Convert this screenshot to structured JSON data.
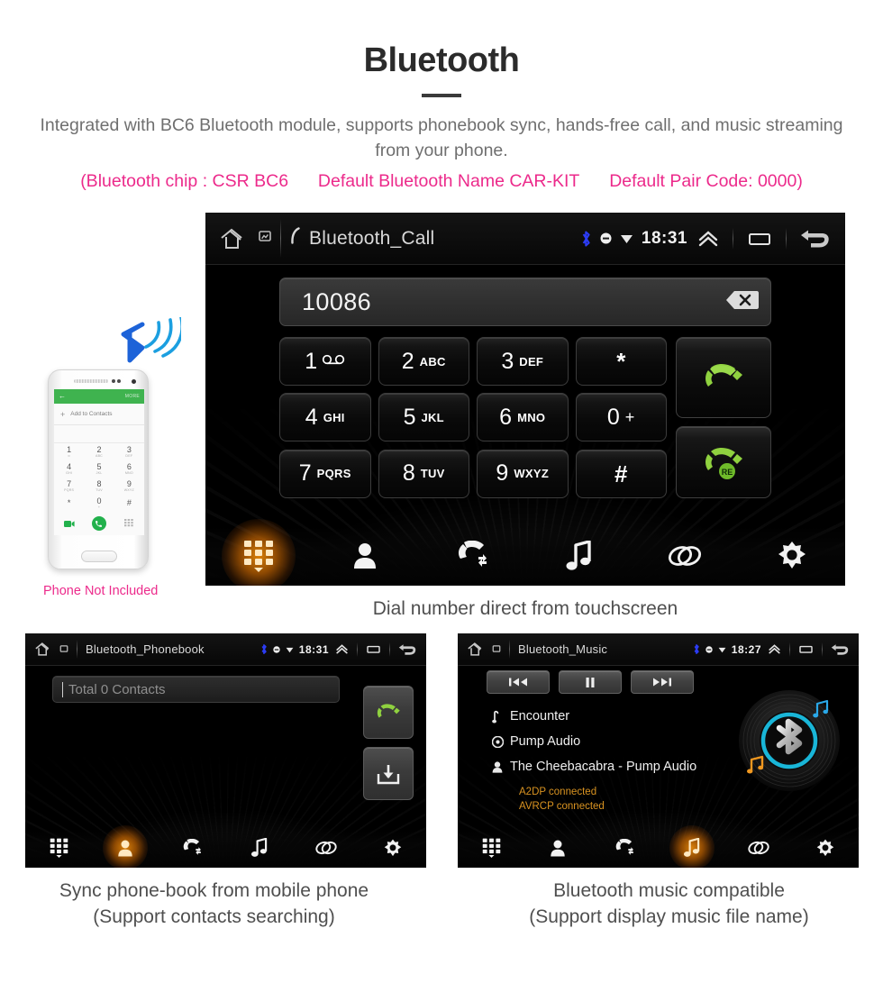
{
  "header": {
    "title": "Bluetooth",
    "description": "Integrated with BC6 Bluetooth module, supports phonebook sync, hands-free call, and music streaming from your phone.",
    "spec_chip": "(Bluetooth chip : CSR BC6",
    "spec_name": "Default Bluetooth Name CAR-KIT",
    "spec_pair": "Default Pair Code: 0000)",
    "accent_pink": "#ec2a8b",
    "text_grey": "#6f6f6f"
  },
  "illustration": {
    "note": "Phone Not Included",
    "phone_screen": {
      "more_label": "MORE",
      "add_contacts": "Add to Contacts",
      "keys": [
        {
          "d": "1",
          "l": "∞"
        },
        {
          "d": "2",
          "l": "ABC"
        },
        {
          "d": "3",
          "l": "DEF"
        },
        {
          "d": "4",
          "l": "GHI"
        },
        {
          "d": "5",
          "l": "JKL"
        },
        {
          "d": "6",
          "l": "MNO"
        },
        {
          "d": "7",
          "l": "PQRS"
        },
        {
          "d": "8",
          "l": "TUV"
        },
        {
          "d": "9",
          "l": "WXYZ"
        },
        {
          "d": "*",
          "l": ""
        },
        {
          "d": "0",
          "l": "+"
        },
        {
          "d": "#",
          "l": ""
        }
      ]
    }
  },
  "call_screen": {
    "status": {
      "title": "Bluetooth_Call",
      "clock": "18:31",
      "bluetooth_color": "#2c3cf5"
    },
    "dial": {
      "value": "10086",
      "backspace_icon": "backspace-icon"
    },
    "keys": [
      {
        "digit": "1",
        "letters": "voicemail",
        "type": "voicemail"
      },
      {
        "digit": "2",
        "letters": "ABC",
        "type": "digit"
      },
      {
        "digit": "3",
        "letters": "DEF",
        "type": "digit"
      },
      {
        "digit": "*",
        "letters": "",
        "type": "symbol"
      },
      {
        "digit": "4",
        "letters": "GHI",
        "type": "digit"
      },
      {
        "digit": "5",
        "letters": "JKL",
        "type": "digit"
      },
      {
        "digit": "6",
        "letters": "MNO",
        "type": "digit"
      },
      {
        "digit": "0",
        "letters": "+",
        "type": "digit"
      },
      {
        "digit": "7",
        "letters": "PQRS",
        "type": "digit"
      },
      {
        "digit": "8",
        "letters": "TUV",
        "type": "digit"
      },
      {
        "digit": "9",
        "letters": "WXYZ",
        "type": "digit"
      },
      {
        "digit": "#",
        "letters": "",
        "type": "symbol"
      }
    ],
    "call_button": "call-icon",
    "redial_button": "redial-icon",
    "redial_badge": "RE",
    "caption": "Dial number direct from touchscreen"
  },
  "tabs": [
    {
      "name": "keypad",
      "icon": "keypad-icon"
    },
    {
      "name": "contacts",
      "icon": "contact-icon"
    },
    {
      "name": "call-log",
      "icon": "call-history-icon"
    },
    {
      "name": "music",
      "icon": "music-note-icon"
    },
    {
      "name": "link",
      "icon": "link-icon"
    },
    {
      "name": "settings",
      "icon": "gear-icon"
    }
  ],
  "phonebook_screen": {
    "status": {
      "title": "Bluetooth_Phonebook",
      "clock": "18:31"
    },
    "search_placeholder": "Total 0 Contacts",
    "side_buttons": [
      {
        "name": "dial-call-button",
        "icon": "call-icon"
      },
      {
        "name": "download-contacts-button",
        "icon": "download-icon"
      }
    ],
    "active_tab": "contacts",
    "caption_line1": "Sync phone-book from mobile phone",
    "caption_line2": "(Support contacts searching)"
  },
  "music_screen": {
    "status": {
      "title": "Bluetooth_Music",
      "clock": "18:27"
    },
    "transport": [
      {
        "name": "previous-track-button",
        "icon": "prev-icon"
      },
      {
        "name": "pause-button",
        "icon": "pause-icon"
      },
      {
        "name": "next-track-button",
        "icon": "next-icon"
      }
    ],
    "track": {
      "title": "Encounter",
      "album": "Pump Audio",
      "artist": "The Cheebacabra - Pump Audio"
    },
    "status_lines": [
      "A2DP connected",
      "AVRCP connected"
    ],
    "status_color": "#d99321",
    "disc_accent": "#19b6d8",
    "active_tab": "music",
    "caption_line1": "Bluetooth music compatible",
    "caption_line2": "(Support display music file name)"
  }
}
